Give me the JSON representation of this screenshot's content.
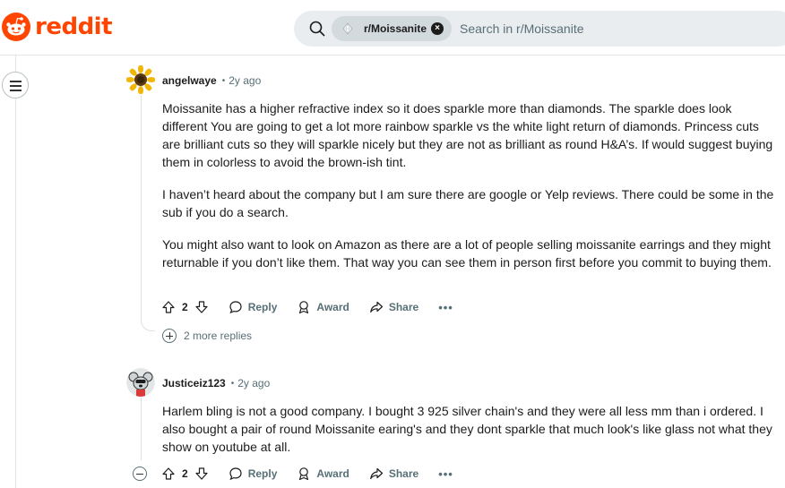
{
  "header": {
    "logo_text": "reddit",
    "search": {
      "community": "r/Moissanite",
      "placeholder": "Search in r/Moissanite"
    }
  },
  "comments": [
    {
      "author": "angelwaye",
      "time": "2y ago",
      "paragraphs": [
        "Moissanite has a higher refractive index so it does sparkle more than diamonds. The sparkle does look different You are going to get a lot more rainbow sparkle vs the white light return of diamonds. Princess cuts are brilliant cuts so they will sparkle nicely but they are not as brilliant as round H&A’s. If would suggest buying them in colorless to avoid the brown-ish tint.",
        "I haven’t heard about the company but I am sure there are google or Yelp reviews. There could be some in the sub if you do a search.",
        "You might also want to look on Amazon as there are a lot of people selling moissanite earrings and they might returnable if you don’t like them. That way you can see them in person first before you commit to buying them."
      ],
      "score": "2",
      "reply_label": "Reply",
      "award_label": "Award",
      "share_label": "Share",
      "more_replies": "2 more replies"
    },
    {
      "author": "Justiceiz123",
      "time": "2y ago",
      "paragraphs": [
        "Harlem bling is not a good company. I bought 3 925 silver chain's and they were all less mm than i ordered. I also bought a pair of round Moissanite earing's and they dont sparkle that much look's like glass not what they show on youtube at all."
      ],
      "score": "2",
      "reply_label": "Reply",
      "award_label": "Award",
      "share_label": "Share"
    }
  ],
  "colors": {
    "brand": "#ff4500",
    "meta_text": "#576f76",
    "search_bg": "#eaedef"
  },
  "icons": [
    "reddit-logo-icon",
    "search-icon",
    "close-icon",
    "menu-icon",
    "upvote-icon",
    "downvote-icon",
    "reply-icon",
    "award-icon",
    "share-icon",
    "more-icon",
    "expand-icon",
    "collapse-icon"
  ]
}
